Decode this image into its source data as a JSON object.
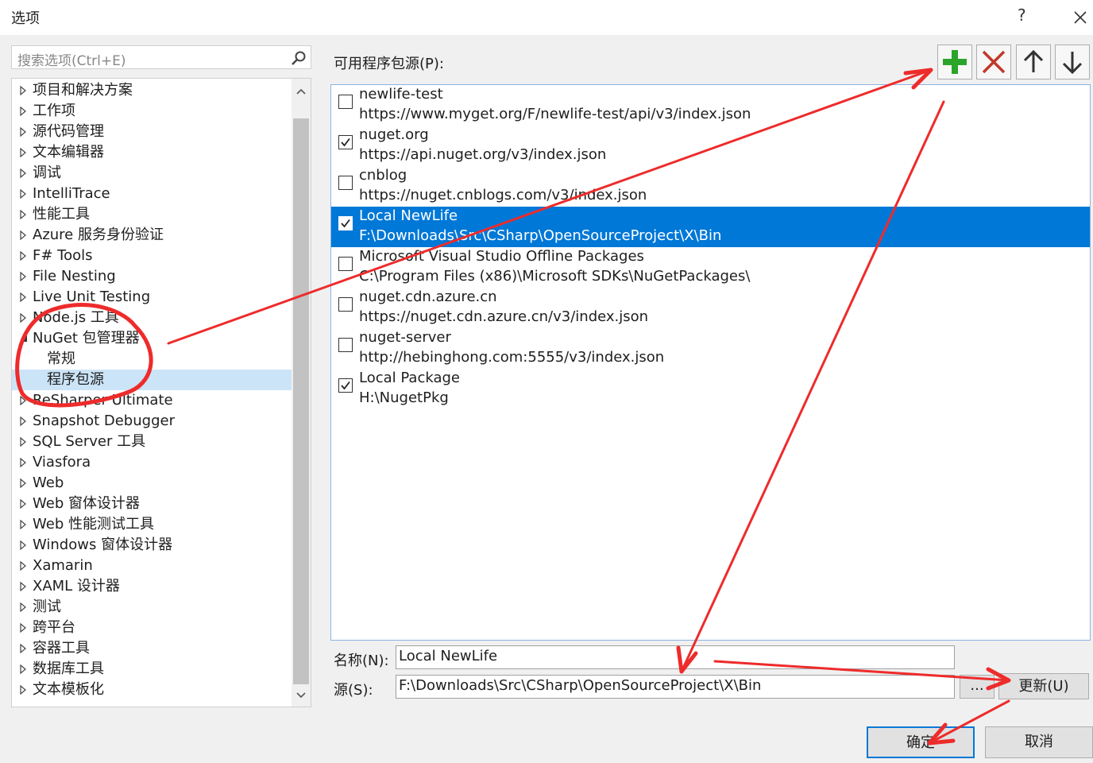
{
  "dialog": {
    "title": "选项",
    "help": "?",
    "close_icon": "close-icon"
  },
  "search": {
    "placeholder": "搜索选项(Ctrl+E)",
    "icon": "search-icon"
  },
  "tree": {
    "items": [
      {
        "label": "项目和解决方案",
        "expanded": false
      },
      {
        "label": "工作项",
        "expanded": false
      },
      {
        "label": "源代码管理",
        "expanded": false
      },
      {
        "label": "文本编辑器",
        "expanded": false
      },
      {
        "label": "调试",
        "expanded": false
      },
      {
        "label": "IntelliTrace",
        "expanded": false
      },
      {
        "label": "性能工具",
        "expanded": false
      },
      {
        "label": "Azure 服务身份验证",
        "expanded": false
      },
      {
        "label": "F# Tools",
        "expanded": false
      },
      {
        "label": "File Nesting",
        "expanded": false
      },
      {
        "label": "Live Unit Testing",
        "expanded": false
      },
      {
        "label": "Node.js 工具",
        "expanded": false
      },
      {
        "label": "NuGet 包管理器",
        "expanded": true
      },
      {
        "label": "常规",
        "child": true
      },
      {
        "label": "程序包源",
        "child": true,
        "selected": true
      },
      {
        "label": "ReSharper Ultimate",
        "expanded": false
      },
      {
        "label": "Snapshot Debugger",
        "expanded": false
      },
      {
        "label": "SQL Server 工具",
        "expanded": false
      },
      {
        "label": "Viasfora",
        "expanded": false
      },
      {
        "label": "Web",
        "expanded": false
      },
      {
        "label": "Web 窗体设计器",
        "expanded": false
      },
      {
        "label": "Web 性能测试工具",
        "expanded": false
      },
      {
        "label": "Windows 窗体设计器",
        "expanded": false
      },
      {
        "label": "Xamarin",
        "expanded": false
      },
      {
        "label": "XAML 设计器",
        "expanded": false
      },
      {
        "label": "测试",
        "expanded": false
      },
      {
        "label": "跨平台",
        "expanded": false
      },
      {
        "label": "容器工具",
        "expanded": false
      },
      {
        "label": "数据库工具",
        "expanded": false
      },
      {
        "label": "文本模板化",
        "expanded": false
      }
    ]
  },
  "sources": {
    "label": "可用程序包源(P):",
    "toolbar": {
      "add": "plus-icon",
      "remove": "x-icon",
      "up": "arrow-up-icon",
      "down": "arrow-down-icon"
    },
    "items": [
      {
        "name": "newlife-test",
        "url": "https://www.myget.org/F/newlife-test/api/v3/index.json",
        "checked": false
      },
      {
        "name": "nuget.org",
        "url": "https://api.nuget.org/v3/index.json",
        "checked": true
      },
      {
        "name": "cnblog",
        "url": "https://nuget.cnblogs.com/v3/index.json",
        "checked": false
      },
      {
        "name": "Local NewLife",
        "url": "F:\\Downloads\\Src\\CSharp\\OpenSourceProject\\X\\Bin",
        "checked": true,
        "selected": true
      },
      {
        "name": "Microsoft Visual Studio Offline Packages",
        "url": "C:\\Program Files (x86)\\Microsoft SDKs\\NuGetPackages\\",
        "checked": false
      },
      {
        "name": "nuget.cdn.azure.cn",
        "url": "https://nuget.cdn.azure.cn/v3/index.json",
        "checked": false
      },
      {
        "name": "nuget-server",
        "url": "http://hebinghong.com:5555/v3/index.json",
        "checked": false
      },
      {
        "name": "Local Package",
        "url": "H:\\NugetPkg",
        "checked": true
      }
    ]
  },
  "form": {
    "name_label": "名称(N):",
    "name_value": "Local NewLife",
    "source_label": "源(S):",
    "source_value": "F:\\Downloads\\Src\\CSharp\\OpenSourceProject\\X\\Bin",
    "browse_label": "...",
    "update_label": "更新(U)"
  },
  "footer": {
    "ok_label": "确定",
    "cancel_label": "取消"
  },
  "colors": {
    "accent": "#0078d7",
    "annotation": "#ee2b2b",
    "add": "#2aa52a",
    "remove": "#c0392b"
  }
}
